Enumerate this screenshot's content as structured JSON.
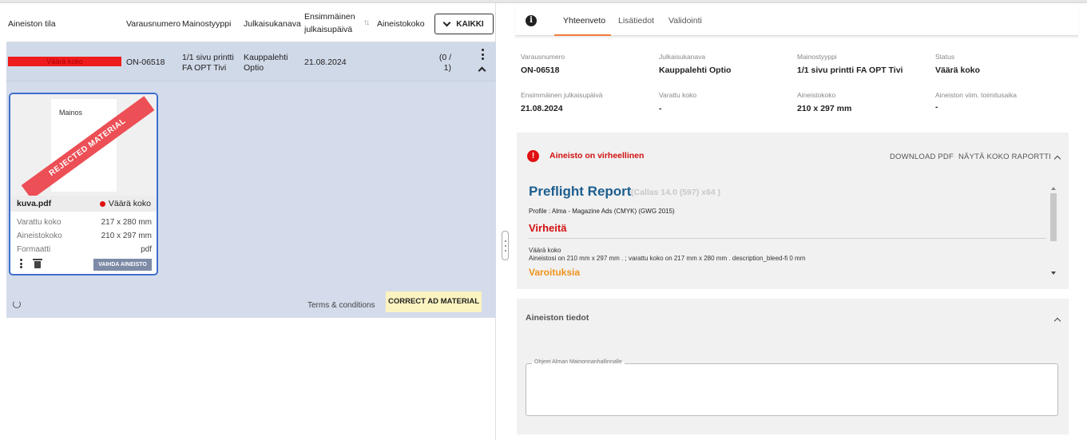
{
  "table": {
    "headers": {
      "aineiston_tila": "Aineiston tila",
      "varausnumero": "Varausnumero",
      "mainostyyppi": "Mainostyyppi",
      "julkaisukanava": "Julkaisukanava",
      "ensimmainen_1": "Ensimmäinen",
      "ensimmainen_2": "julkaisupäivä",
      "aineistokoko": "Aineistokoko"
    },
    "filter_button": "KAIKKI",
    "row": {
      "status": "Väärä koko",
      "varausnumero": "ON-06518",
      "mainostyyppi_1": "1/1 sivu printti",
      "mainostyyppi_2": "FA OPT Tivi",
      "julkaisukanava_1": "Kauppalehti",
      "julkaisukanava_2": "Optio",
      "paiva": "21.08.2024",
      "koko_1": "(0 /",
      "koko_2": "1)"
    }
  },
  "material_card": {
    "thumbnail_text": "Mainos",
    "stamp": "REJECTED MATERIAL",
    "file_name": "kuva.pdf",
    "file_status": "Väärä koko",
    "rows": [
      {
        "label": "Varattu koko",
        "value": "217 x 280 mm"
      },
      {
        "label": "Aineistokoko",
        "value": "210 x 297 mm"
      },
      {
        "label": "Formaatti",
        "value": "pdf"
      }
    ],
    "replace_button": "VAIHDA AINEISTO"
  },
  "footer": {
    "terms": "Terms & conditions",
    "correct_button": "CORRECT AD MATERIAL"
  },
  "tabs": [
    "Yhteenveto",
    "Lisätiedot",
    "Validointi"
  ],
  "summary": {
    "varausnumero": {
      "label": "Varausnumero",
      "value": "ON-06518"
    },
    "julkaisukanava": {
      "label": "Julkaisukanava",
      "value": "Kauppalehti Optio"
    },
    "mainostyyppi": {
      "label": "Mainostyyppi",
      "value": "1/1 sivu printti FA OPT Tivi"
    },
    "status": {
      "label": "Status",
      "value": "Väärä koko"
    },
    "ensimmainen": {
      "label": "Ensimmäinen julkaisupäivä",
      "value": "21.08.2024"
    },
    "varattu": {
      "label": "Varattu koko",
      "value": "-"
    },
    "aineistokoko": {
      "label": "Aineistokoko",
      "value": "210 x 297 mm"
    },
    "toimitusaika": {
      "label": "Aineiston viim. toimitusaika",
      "value": "-"
    }
  },
  "error_panel": {
    "title": "Aineisto on virheellinen",
    "download": "DOWNLOAD PDF",
    "report": "NÄYTÄ KOKO RAPORTTI",
    "preflight_title": "Preflight Report",
    "preflight_sub": "(Callas 14.0 (597) x64 )",
    "profile": "Profile : Alma - Magazine Ads (CMYK) (GWG 2015)",
    "errors_heading": "Virheitä",
    "error_name": "Väärä koko",
    "error_detail": "Aineistosi on  210 mm x 297 mm . ; varattu koko on  217 mm x 280 mm . description_bleed-fi  0 mm",
    "warnings_heading": "Varoituksia"
  },
  "details_panel": {
    "title": "Aineiston tiedot",
    "textarea_label": "Ohjeet Alman Mainonnanhallinnalle",
    "textarea_value": ""
  },
  "colors": {
    "accent_tab": "#f37a3d",
    "error": "#e01010",
    "card_border": "#3d6fce",
    "row_bg": "#d0d9e8",
    "correct_button_bg": "#fbf3c0"
  }
}
